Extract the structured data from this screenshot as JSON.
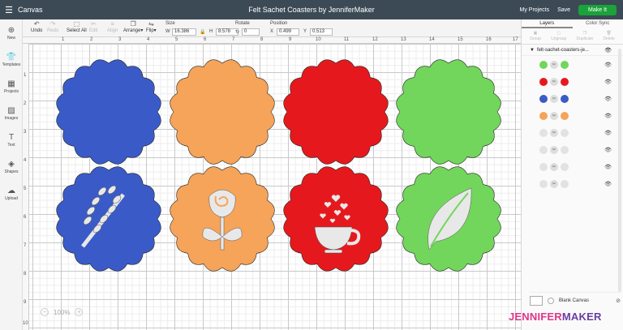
{
  "topbar": {
    "menu_icon": "hamburger-menu-icon",
    "section_label": "Canvas",
    "title": "Felt Sachet Coasters by JenniferMaker",
    "my_projects": "My Projects",
    "save": "Save",
    "make_it": "Make It"
  },
  "toolbar": {
    "undo": "Undo",
    "redo": "Redo",
    "select_all": "Select All",
    "edit": "Edit",
    "align": "Align",
    "arrange": "Arrange",
    "flip": "Flip",
    "size_label": "Size",
    "w_label": "W",
    "w_value": "16.386",
    "h_label": "H",
    "h_value": "8.578",
    "rotate_label": "Rotate",
    "rotate_value": "0",
    "position_label": "Position",
    "x_label": "X",
    "x_value": "0.499",
    "y_label": "Y",
    "y_value": "0.513"
  },
  "sidebar": {
    "items": [
      {
        "label": "New",
        "icon": "plus-icon"
      },
      {
        "label": "Templates",
        "icon": "shirt-icon"
      },
      {
        "label": "Projects",
        "icon": "grid-icon"
      },
      {
        "label": "Images",
        "icon": "image-icon"
      },
      {
        "label": "Text",
        "icon": "text-icon"
      },
      {
        "label": "Shapes",
        "icon": "shapes-icon"
      },
      {
        "label": "Upload",
        "icon": "cloud-upload-icon"
      }
    ]
  },
  "ruler": {
    "top": [
      "1",
      "2",
      "3",
      "4",
      "5",
      "6",
      "7",
      "8",
      "9",
      "10",
      "11",
      "12",
      "13",
      "14",
      "15",
      "16",
      "17"
    ],
    "left": [
      "1",
      "2",
      "3",
      "4",
      "5",
      "6",
      "7",
      "8",
      "9",
      "10"
    ]
  },
  "canvas": {
    "zoom": "100%",
    "colors": {
      "blue": "#3a5bc7",
      "orange": "#f5a45a",
      "red": "#e5191d",
      "green": "#72d65c",
      "cutout": "#e8e8e8"
    },
    "motifs": [
      "lavender-sprig-icon",
      "rose-icon",
      "teacup-hearts-icon",
      "leaf-icon"
    ]
  },
  "layers_panel": {
    "tabs": [
      "Layers",
      "Color Sync"
    ],
    "tools": [
      "Group",
      "Ungroup",
      "Duplicate",
      "Delete"
    ],
    "group_name": "felt-sachet-coasters-je...",
    "rows": [
      {
        "color": "#72d65c"
      },
      {
        "color": "#e5191d"
      },
      {
        "color": "#3a5bc7"
      },
      {
        "color": "#f5a45a"
      },
      {
        "color": "#e2e2e2"
      },
      {
        "color": "#e2e2e2"
      },
      {
        "color": "#e2e2e2"
      },
      {
        "color": "#e2e2e2"
      }
    ],
    "blank_canvas": "Blank Canvas"
  },
  "brand": {
    "part1": "JENNIFER",
    "part2": "MAKER"
  }
}
